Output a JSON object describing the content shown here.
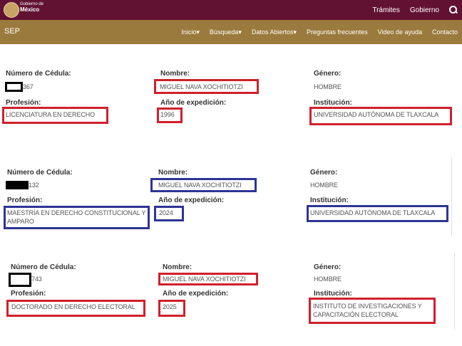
{
  "gov_header": {
    "logo_line1": "Gobierno de",
    "logo_line2": "México",
    "nav": [
      "Trámites",
      "Gobierno"
    ]
  },
  "sep_header": {
    "brand": "SEP",
    "nav": [
      {
        "label": "Inicio",
        "dropdown": true
      },
      {
        "label": "Búsqueda",
        "dropdown": true
      },
      {
        "label": "Datos Abiertos",
        "dropdown": true
      },
      {
        "label": "Preguntas frecuentes",
        "dropdown": false
      },
      {
        "label": "Video de ayuda",
        "dropdown": false
      },
      {
        "label": "Contacto",
        "dropdown": false
      }
    ]
  },
  "labels": {
    "cedula": "Número de Cédula:",
    "nombre": "Nombre:",
    "genero": "Género:",
    "profesion": "Profesión:",
    "anio": "Año de expedición:",
    "institucion": "Institución:"
  },
  "records": [
    {
      "cedula_suffix": "367",
      "nombre": "MIGUEL NAVA XOCHITIOTZI",
      "genero": "HOMBRE",
      "profesion": "LICENCIATURA EN DERECHO",
      "anio": "1996",
      "institucion": "UNIVERSIDAD AUTÓNOMA DE TLAXCALA"
    },
    {
      "cedula_suffix": "132",
      "nombre": "MIGUEL NAVA XOCHITIOTZI",
      "genero": "HOMBRE",
      "profesion": "MAESTRÍA EN DERECHO CONSTITUCIONAL Y AMPARO",
      "anio": "2024",
      "institucion": "UNIVERSIDAD AUTÓNOMA DE TLAXCALA"
    },
    {
      "cedula_suffix": "743",
      "nombre": "MIGUEL NAVA XOCHITIOTZI",
      "genero": "HOMBRE",
      "profesion": "DOCTORADO EN DERECHO ELECTORAL",
      "anio": "2025",
      "institucion": "INSTITUTO DE INVESTIGACIONES Y CAPACITACIÓN ELECTORAL"
    }
  ],
  "colors": {
    "gov_bar": "#611232",
    "sep_bar": "#9b7a3d",
    "highlight_red": "#d0202c",
    "highlight_blue": "#2d3594",
    "redaction": "#000000"
  }
}
